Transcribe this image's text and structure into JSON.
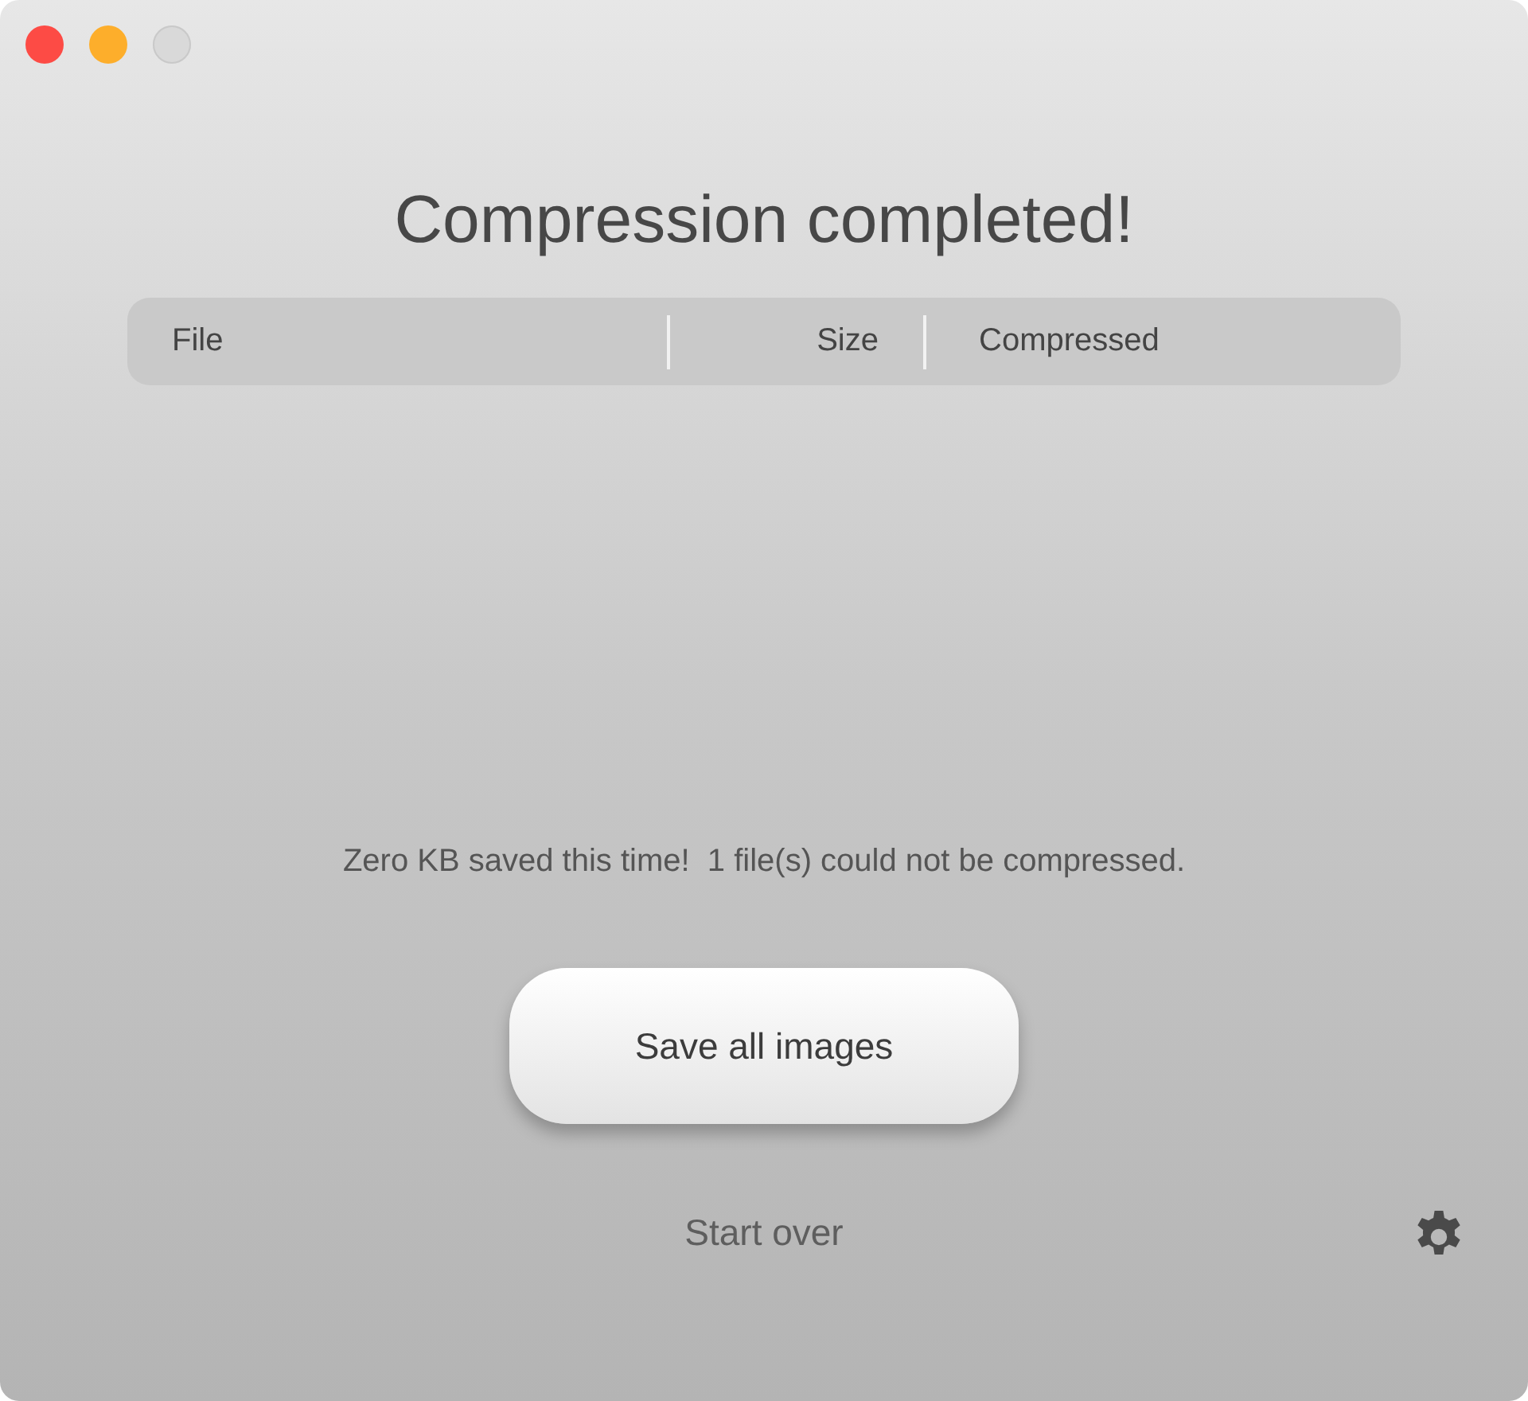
{
  "window_controls": [
    {
      "kind": "close",
      "disabled": false
    },
    {
      "kind": "minimize",
      "disabled": false
    },
    {
      "kind": "zoom",
      "disabled": true
    }
  ],
  "title": "Compression completed!",
  "table": {
    "columns": [
      {
        "label": "File"
      },
      {
        "label": "Size"
      },
      {
        "label": "Compressed"
      }
    ]
  },
  "message": "Zero KB saved this time!  1 file(s) could not be compressed.",
  "save_button": "Save all images",
  "start_over": "Start over"
}
